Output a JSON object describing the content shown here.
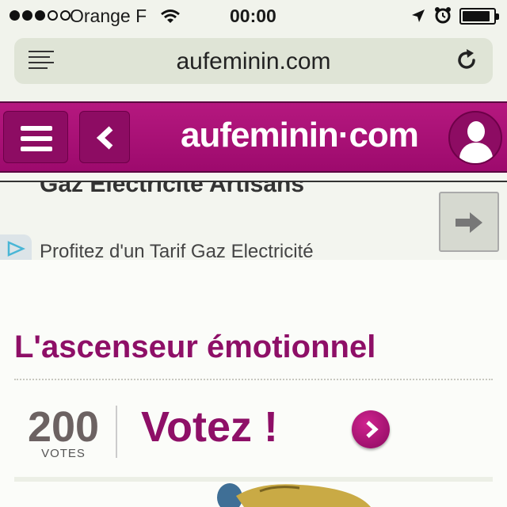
{
  "status_bar": {
    "signal_bars_filled": 3,
    "signal_bars_total": 5,
    "carrier": "Orange F",
    "time": "00:00",
    "battery_level": 0.9,
    "icons": [
      "wifi-icon",
      "location-arrow-icon",
      "alarm-icon",
      "battery-icon"
    ]
  },
  "browser": {
    "url": "aufeminin.com",
    "icons": [
      "reader-icon",
      "reload-icon"
    ]
  },
  "site_header": {
    "logo": "aufeminin·com",
    "brand_color": "#a81276",
    "icons": [
      "menu-icon",
      "back-chevron-icon",
      "user-icon"
    ]
  },
  "ad": {
    "title": "Gaz Electricité Artisans",
    "text": "Profitez d'un Tarif Gaz Electricité",
    "icons": [
      "adchoices-icon",
      "arrow-right-icon"
    ]
  },
  "article": {
    "title": "L'ascenseur émotionnel",
    "accent_color": "#8e0f67"
  },
  "votes": {
    "count": "200",
    "label": "VOTES",
    "cta": "Votez !",
    "icons": [
      "chevron-right-icon"
    ]
  }
}
